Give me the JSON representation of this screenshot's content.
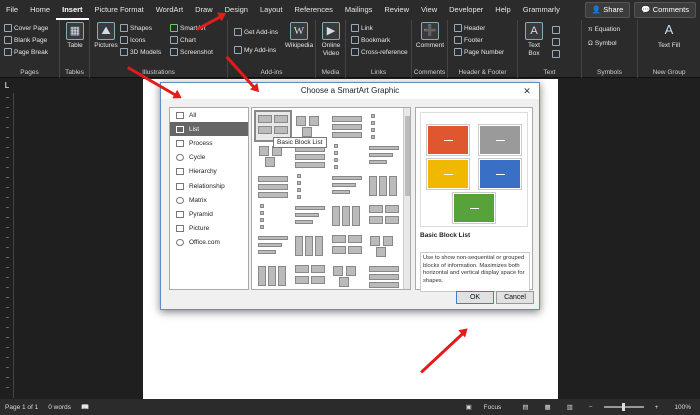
{
  "menubar": {
    "tabs": [
      "File",
      "Home",
      "Insert",
      "Picture Format",
      "WordArt",
      "Draw",
      "Design",
      "Layout",
      "References",
      "Mailings",
      "Review",
      "View",
      "Developer",
      "Help",
      "Grammarly"
    ],
    "active": "Insert",
    "share": "Share",
    "comments": "Comments"
  },
  "ribbon": {
    "pages": {
      "label": "Pages",
      "items": [
        "Cover Page",
        "Blank Page",
        "Page Break"
      ]
    },
    "tables": {
      "label": "Tables",
      "table": "Table"
    },
    "illustrations": {
      "label": "Illustrations",
      "pictures": "Pictures",
      "shapes": "Shapes",
      "icons": "Icons",
      "models": "3D Models",
      "smartart": "SmartArt",
      "chart": "Chart",
      "screenshot": "Screenshot"
    },
    "addins": {
      "label": "Add-ins",
      "get": "Get Add-ins",
      "my": "My Add-ins",
      "wikipedia": "Wikipedia"
    },
    "media": {
      "label": "Media",
      "online_video": "Online Video"
    },
    "links": {
      "label": "Links",
      "items": [
        "Link",
        "Bookmark",
        "Cross-reference"
      ]
    },
    "comments": {
      "label": "Comments",
      "comment": "Comment"
    },
    "header_footer": {
      "label": "Header & Footer",
      "items": [
        "Header",
        "Footer",
        "Page Number"
      ]
    },
    "text": {
      "label": "Text",
      "textbox": "Text Box"
    },
    "symbols": {
      "label": "Symbols",
      "items": [
        "Equation",
        "Symbol"
      ]
    },
    "new_group": {
      "label": "New Group",
      "text_fill": "Text Fill"
    }
  },
  "dialog": {
    "title": "Choose a SmartArt Graphic",
    "categories": [
      "All",
      "List",
      "Process",
      "Cycle",
      "Hierarchy",
      "Relationship",
      "Matrix",
      "Pyramid",
      "Picture",
      "Office.com"
    ],
    "selected_category": "List",
    "tooltip": "Basic Block List",
    "preview_title": "Basic Block List",
    "preview_description": "Use to show non-sequential or grouped blocks of information. Maximizes both horizontal and vertical display space for shapes.",
    "preview_colors": [
      "#e0562e",
      "#9a9a9a",
      "#f0b800",
      "#3a6fc6",
      "#57a23a"
    ],
    "ok": "OK",
    "cancel": "Cancel"
  },
  "statusbar": {
    "page": "Page 1 of 1",
    "words": "0 words",
    "focus": "Focus",
    "zoom": "100%"
  }
}
